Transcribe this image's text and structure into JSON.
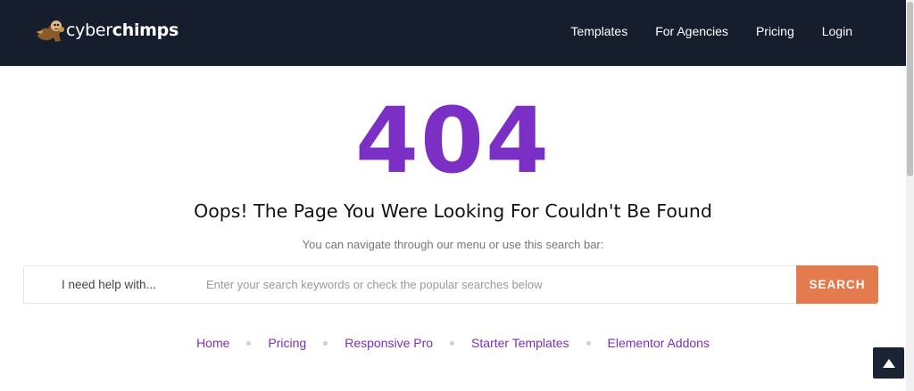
{
  "brand": {
    "name_prefix": "cyber",
    "name_suffix": "chimps",
    "logo_icon": "chimp-mascot-icon"
  },
  "nav": {
    "items": [
      {
        "label": "Templates"
      },
      {
        "label": "For Agencies"
      },
      {
        "label": "Pricing"
      },
      {
        "label": "Login"
      }
    ]
  },
  "error": {
    "code": "404",
    "headline": "Oops! The Page You Were Looking For Couldn't Be Found",
    "subtext": "You can navigate through our menu or use this search bar:"
  },
  "search": {
    "label": "I need help with...",
    "placeholder": "Enter your search keywords or check the popular searches below",
    "value": "",
    "button_label": "SEARCH"
  },
  "quick_links": [
    {
      "label": "Home"
    },
    {
      "label": "Pricing"
    },
    {
      "label": "Responsive Pro"
    },
    {
      "label": "Starter Templates"
    },
    {
      "label": "Elementor Addons"
    }
  ],
  "back_to_top": {
    "icon": "triangle-up-icon"
  },
  "colors": {
    "navbar_bg": "#161d2c",
    "accent_purple": "#7b2fc4",
    "search_button": "#e37b4e",
    "back_to_top_bg": "#1b2435"
  }
}
